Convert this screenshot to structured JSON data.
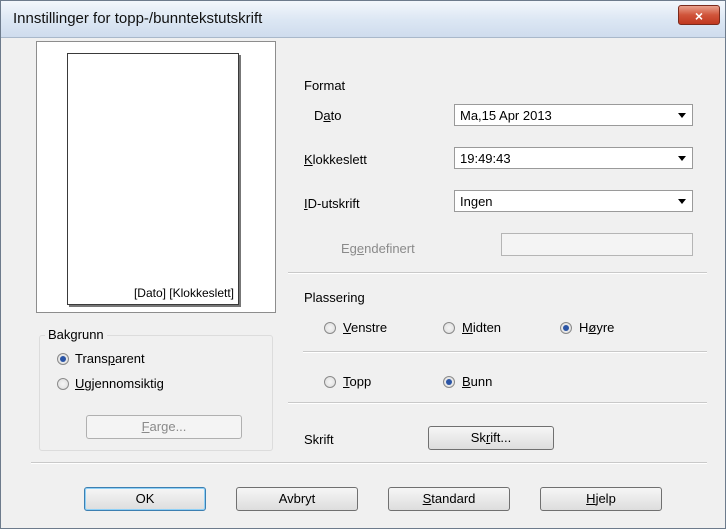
{
  "window": {
    "title": "Innstillinger for topp-/bunntekstutskrift",
    "close": "×"
  },
  "preview": {
    "text": "[Dato] [Klokkeslett]"
  },
  "background": {
    "legend": "Bakgrunn",
    "options": [
      {
        "pre": "Trans",
        "ul": "p",
        "post": "arent",
        "checked": true
      },
      {
        "pre": "",
        "ul": "U",
        "post": "gjennomsiktig",
        "checked": false
      }
    ],
    "color_button": {
      "pre": "",
      "ul": "F",
      "post": "arge..."
    }
  },
  "format": {
    "heading": "Format",
    "date_label": {
      "pre": "D",
      "ul": "a",
      "post": "to"
    },
    "date_value": "Ma,15 Apr 2013",
    "time_label": {
      "pre": "",
      "ul": "K",
      "post": "lokkeslett"
    },
    "time_value": "19:49:43",
    "id_label": {
      "pre": "",
      "ul": "I",
      "post": "D-utskrift"
    },
    "id_value": "Ingen",
    "custom_label": {
      "pre": "Eg",
      "ul": "e",
      "post": "ndefinert"
    },
    "custom_value": ""
  },
  "placement": {
    "heading": "Plassering",
    "horizontal": [
      {
        "pre": "",
        "ul": "V",
        "post": "enstre",
        "checked": false
      },
      {
        "pre": "",
        "ul": "M",
        "post": "idten",
        "checked": false
      },
      {
        "pre": "H",
        "ul": "ø",
        "post": "yre",
        "checked": true
      }
    ],
    "vertical": [
      {
        "pre": "",
        "ul": "T",
        "post": "opp",
        "checked": false
      },
      {
        "pre": "",
        "ul": "B",
        "post": "unn",
        "checked": true
      }
    ]
  },
  "font": {
    "label": "Skrift",
    "button": {
      "pre": "Sk",
      "ul": "r",
      "post": "ift..."
    }
  },
  "buttons": {
    "ok": "OK",
    "cancel": "Avbryt",
    "standard": {
      "pre": "",
      "ul": "S",
      "post": "tandard"
    },
    "help": {
      "pre": "",
      "ul": "H",
      "post": "jelp"
    }
  }
}
